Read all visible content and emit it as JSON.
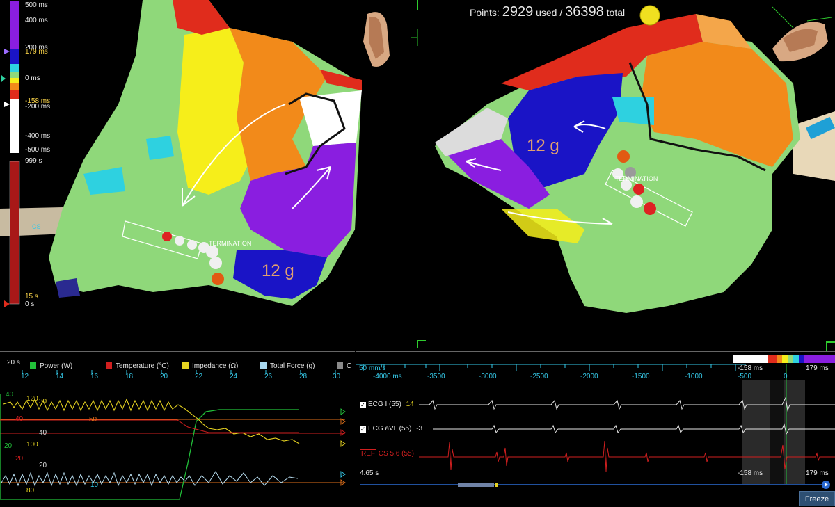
{
  "color_scale": {
    "labels": [
      "500 ms",
      "400 ms",
      "200 ms",
      "179 ms",
      "0 ms",
      "-158 ms",
      "-200 ms",
      "-400 ms",
      "-500 ms",
      "999 s",
      "15 s",
      "0 s"
    ]
  },
  "points": {
    "prefix": "Points:",
    "used": "2929",
    "used_label": "used /",
    "total": "36398",
    "total_label": "total"
  },
  "map_left": {
    "cs_label": "CS",
    "termination_label": "TERMINATION",
    "force_label": "12 g"
  },
  "map_right": {
    "termination_label": "TERMINATION",
    "force_label": "12 g"
  },
  "graphs": {
    "time_window": "20 s",
    "legend": [
      {
        "label": "Power (W)",
        "color": "#22c13a"
      },
      {
        "label": "Temperature (°C)",
        "color": "#d11f1f"
      },
      {
        "label": "Impedance (Ω)",
        "color": "#e6d321"
      },
      {
        "label": "Total Force (g)",
        "color": "#a8d8f0"
      },
      {
        "label": "C",
        "color": "#8a8a8a"
      }
    ],
    "ticks": [
      "12",
      "14",
      "16",
      "18",
      "20",
      "22",
      "24",
      "26",
      "28",
      "30"
    ],
    "y_labels": {
      "power_top": "40",
      "imp_120": "120",
      "imp_30": "30",
      "temp_40_left": "40",
      "temp_50": "50",
      "temp_40_mid": "40",
      "power_20": "20",
      "imp_100": "100",
      "temp_20": "20",
      "force_20": "20",
      "force_10": "10",
      "imp_80": "80"
    }
  },
  "ecg": {
    "speed": "50 mm/s",
    "ticks": [
      "-4000 ms",
      "-3500",
      "-3000",
      "-2500",
      "-2000",
      "-1500",
      "-1000",
      "-500",
      "0"
    ],
    "window_left": "-158 ms",
    "window_zero": "0",
    "window_right": "179 ms",
    "channels": [
      {
        "name": "ECG I (55)",
        "value": "14"
      },
      {
        "name": "ECG aVL (55)",
        "value": "-3"
      },
      {
        "ref": "REF",
        "name": "CS 5,6 (55)"
      }
    ],
    "elapsed": "4.65 s",
    "bottom_left": "-158 ms",
    "bottom_right": "179 ms",
    "freeze_label": "Freeze"
  }
}
